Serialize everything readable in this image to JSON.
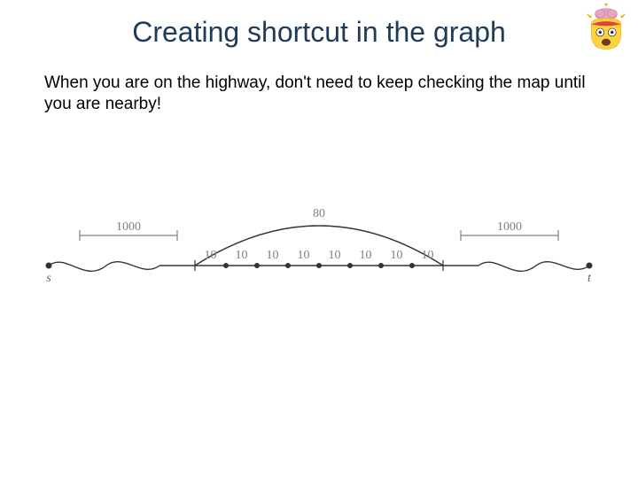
{
  "title": "Creating shortcut in the graph",
  "body": "When you are on the highway, don't need to keep checking the map until you are nearby!",
  "emoji_name": "exploding-head-emoji",
  "diagram": {
    "left_span_label": "1000",
    "right_span_label": "1000",
    "arc_label": "80",
    "segment_labels": [
      "10",
      "10",
      "10",
      "10",
      "10",
      "10",
      "10",
      "10"
    ],
    "left_node_label": "s",
    "right_node_label": "t"
  }
}
